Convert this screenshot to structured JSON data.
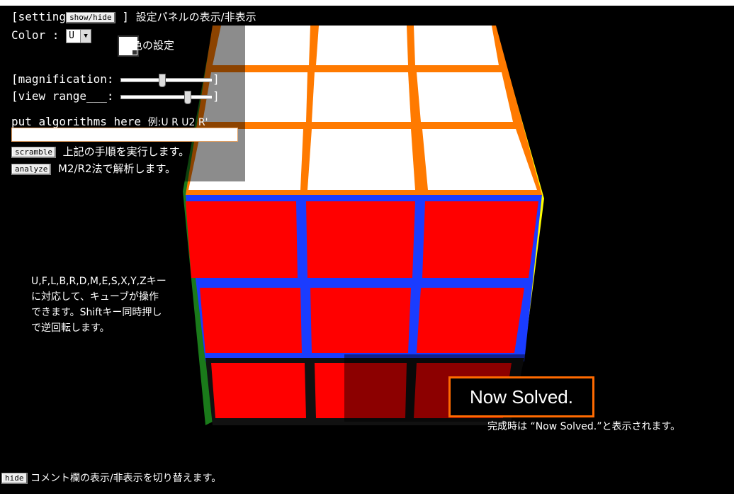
{
  "settings": {
    "open_bracket": "[setting",
    "close_bracket": "]",
    "show_hide_label": "show/hide",
    "toggle_desc": "設定パネルの表示/非表示",
    "color_label": "Color :",
    "color_select_value": "U",
    "color_desc": "色の設定",
    "magnification_label": "[magnification:",
    "view_range_label": "[view range___:",
    "slider_end": "]",
    "magnification_value": 0.45,
    "view_range_value": 0.75,
    "algorithm_label": "put algorithms here",
    "algorithm_example": "例:U R U2 R'",
    "algorithm_value": "",
    "scramble_label": "scramble",
    "scramble_desc": "上記の手順を実行します。",
    "analyze_label": "analyze",
    "analyze_desc": "M2/R2法で解析します。"
  },
  "instructions": "U,F,L,B,R,D,M,E,S,X,Y,Zキー\nに対応して、キューブが操作\nできます。Shiftキー同時押し\nで逆回転します。",
  "status": {
    "solved_text": "Now Solved.",
    "solved_note": "完成時は “Now Solved.”と表示されます。"
  },
  "footer": {
    "hide_label": "hide",
    "hide_desc": "コメント欄の表示/非表示を切り替えます。"
  },
  "cube_colors": {
    "top": "#ffffff",
    "front": "#ff0000",
    "left": "#1a7a1a",
    "right": "#ffff00",
    "behind_top": "#ff7a00",
    "behind_front": "#1a3cff"
  }
}
